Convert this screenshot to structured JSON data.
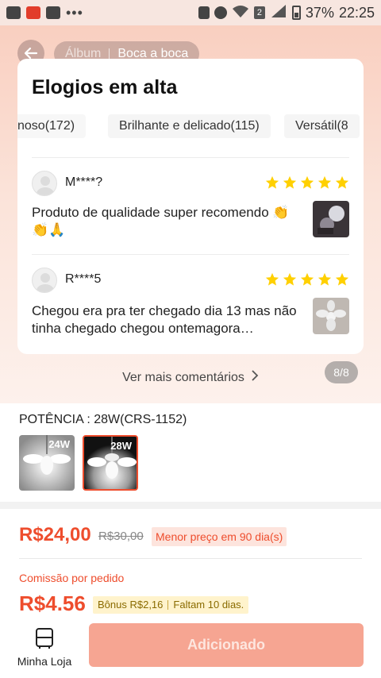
{
  "status_bar": {
    "battery": "37%",
    "time": "22:25",
    "sim": "2"
  },
  "header": {
    "crumb_album": "Álbum",
    "crumb_active": "Boca a boca"
  },
  "reviews_card": {
    "title": "Elogios em alta",
    "tags": [
      "noso(172)",
      "Brilhante e delicado(115)",
      "Versátil(8"
    ],
    "reviews": [
      {
        "name": "M****?",
        "stars": 5,
        "text": " Produto de qualidade super recomendo 👏👏🙏"
      },
      {
        "name": "R****5",
        "stars": 5,
        "text": "Chegou era pra ter chegado dia 13 mas não tinha chegado chegou ontemagora…"
      }
    ]
  },
  "see_more": "Ver mais comentários",
  "page_counter": "8/8",
  "variant": {
    "label": "POTÊNCIA : 28W(CRS-1152)",
    "options": [
      {
        "label": "24W",
        "selected": false
      },
      {
        "label": "28W",
        "selected": true
      }
    ]
  },
  "pricing": {
    "price": "R$24,00",
    "old_price": "R$30,00",
    "lowest_badge": "Menor preço em 90 dia(s)",
    "commission_label": "Comissão por pedido",
    "commission_value": "R$4.56",
    "bonus": "Bônus R$2,16",
    "days_left": "Faltam 10 dias."
  },
  "bottom_bar": {
    "store_label": "Minha Loja",
    "add_button": "Adicionado"
  },
  "colors": {
    "accent": "#ee4d2d",
    "star": "#ffd000",
    "button": "#f6a592"
  }
}
